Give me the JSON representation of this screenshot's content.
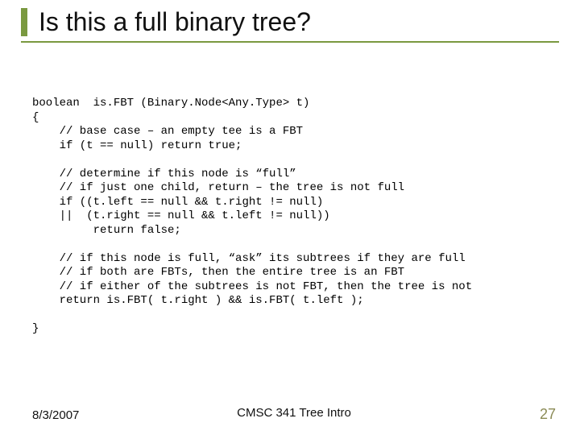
{
  "slide": {
    "title": "Is this a full binary tree?",
    "code_lines": [
      "boolean  is.FBT (Binary.Node<Any.Type> t)",
      "{",
      "    // base case – an empty tee is a FBT",
      "    if (t == null) return true;",
      "",
      "    // determine if this node is “full”",
      "    // if just one child, return – the tree is not full",
      "    if ((t.left == null && t.right != null)",
      "    ||  (t.right == null && t.left != null))",
      "         return false;",
      "",
      "    // if this node is full, “ask” its subtrees if they are full",
      "    // if both are FBTs, then the entire tree is an FBT",
      "    // if either of the subtrees is not FBT, then the tree is not",
      "    return is.FBT( t.right ) && is.FBT( t.left );",
      "",
      "}"
    ]
  },
  "footer": {
    "date": "8/3/2007",
    "center": "CMSC 341 Tree Intro",
    "page": "27"
  }
}
